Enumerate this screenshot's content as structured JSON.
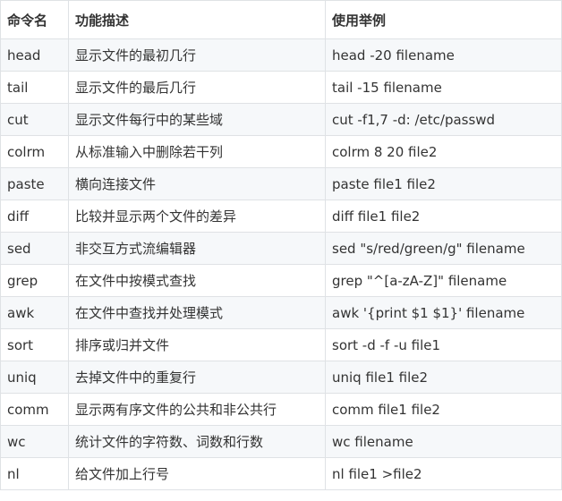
{
  "table": {
    "headers": [
      "命令名",
      "功能描述",
      "使用举例"
    ],
    "rows": [
      [
        "head",
        "显示文件的最初几行",
        "head -20 filename"
      ],
      [
        "tail",
        "显示文件的最后几行",
        "tail -15 filename"
      ],
      [
        "cut",
        "显示文件每行中的某些域",
        "cut -f1,7 -d: /etc/passwd"
      ],
      [
        "colrm",
        "从标准输入中删除若干列",
        "colrm 8 20 file2"
      ],
      [
        "paste",
        "横向连接文件",
        "paste file1 file2"
      ],
      [
        "diff",
        "比较并显示两个文件的差异",
        "diff file1 file2"
      ],
      [
        "sed",
        "非交互方式流编辑器",
        "sed \"s/red/green/g\" filename"
      ],
      [
        "grep",
        "在文件中按模式查找",
        "grep \"^[a-zA-Z]\" filename"
      ],
      [
        "awk",
        "在文件中查找并处理模式",
        "awk '{print $1 $1}' filename"
      ],
      [
        "sort",
        "排序或归并文件",
        "sort -d -f -u file1"
      ],
      [
        "uniq",
        "去掉文件中的重复行",
        "uniq file1 file2"
      ],
      [
        "comm",
        "显示两有序文件的公共和非公共行",
        "comm file1 file2"
      ],
      [
        "wc",
        "统计文件的字符数、词数和行数",
        "wc filename"
      ],
      [
        "nl",
        "给文件加上行号",
        "nl file1 >file2"
      ]
    ]
  }
}
